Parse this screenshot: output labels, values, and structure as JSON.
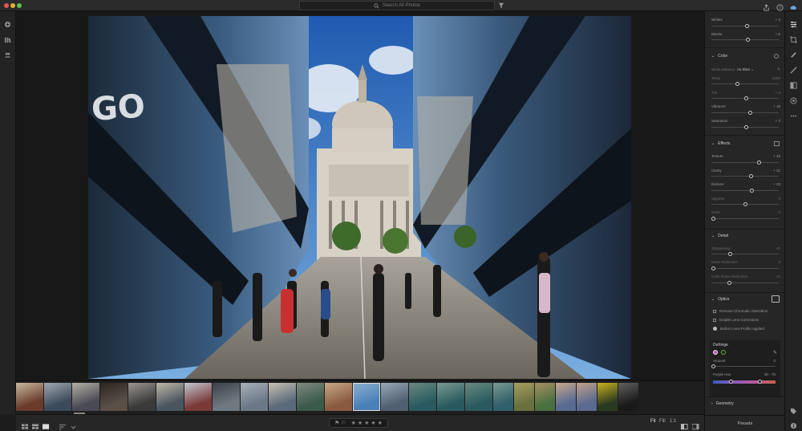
{
  "topbar": {
    "search_placeholder": "Search All Photos"
  },
  "panel": {
    "light_rows": [
      {
        "label": "Whites",
        "value": "+ 4",
        "pos": 0.53
      },
      {
        "label": "Blacks",
        "value": "+ 6",
        "pos": 0.54
      }
    ],
    "color": {
      "title": "Color",
      "white_balance_label": "White Balance",
      "white_balance_value": "As Shot",
      "rows": [
        {
          "label": "Temp",
          "value": "5450",
          "pos": 0.38
        },
        {
          "label": "Tint",
          "value": "+ 3",
          "pos": 0.52
        },
        {
          "label": "Vibrance",
          "value": "+ 16",
          "pos": 0.58
        },
        {
          "label": "Saturation",
          "value": "+ 3",
          "pos": 0.52
        }
      ]
    },
    "effects": {
      "title": "Effects",
      "rows": [
        {
          "label": "Texture",
          "value": "+ 46",
          "pos": 0.72
        },
        {
          "label": "Clarity",
          "value": "+ 21",
          "pos": 0.6
        },
        {
          "label": "Dehaze",
          "value": "+ 23",
          "pos": 0.61
        },
        {
          "label": "Vignette",
          "value": "0",
          "pos": 0.5
        },
        {
          "label": "Grain",
          "value": "0",
          "pos": 0.0
        }
      ]
    },
    "detail": {
      "title": "Detail",
      "rows": [
        {
          "label": "Sharpening",
          "value": "40",
          "pos": 0.27
        },
        {
          "label": "Noise Reduction",
          "value": "0",
          "pos": 0.0
        },
        {
          "label": "Color Noise Reduction",
          "value": "25",
          "pos": 0.25
        }
      ]
    },
    "optics": {
      "title": "Optics",
      "checks": [
        "Remove Chromatic Aberration",
        "Enable Lens Corrections",
        "Built-in Lens Profile Applied"
      ]
    },
    "defringe": {
      "title": "Defringe",
      "amount_label": "Amount",
      "amount_value": "0",
      "purple_hue_label": "Purple Hue",
      "purple_hue_value": "30 - 70"
    },
    "geometry_title": "Geometry",
    "presets_label": "Presets"
  },
  "bottombar": {
    "zoom_fit": "Fit",
    "zoom_fill": "Fill",
    "zoom_1to1": "1:1"
  },
  "filmstrip": {
    "thumbs": [
      [
        "#6a3a2a",
        "#c9b9a0"
      ],
      [
        "#3a4a5a",
        "#a0a8b0"
      ],
      [
        "#4a4a55",
        "#b5b0a5"
      ],
      [
        "#5a5048",
        "#2a2520"
      ],
      [
        "#3a3a3a",
        "#9a9590"
      ],
      [
        "#4a5560",
        "#c0b8a8"
      ],
      [
        "#7a3a3a",
        "#c0c8d0"
      ],
      [
        "#707880",
        "#3a4048"
      ],
      [
        "#6a7888",
        "#a8b0b8"
      ],
      [
        "#5a6a7a",
        "#c8c0b0"
      ],
      [
        "#3a5a4a",
        "#808a80"
      ],
      [
        "#8a5a40",
        "#c8a888"
      ],
      [
        "#4a80b8",
        "#8ab0d0"
      ],
      [
        "#506070",
        "#9aa8b8"
      ],
      [
        "#2a5a60",
        "#6a8a80"
      ],
      [
        "#2a5a60",
        "#7a9a90"
      ],
      [
        "#2a5a60",
        "#6a8a80"
      ],
      [
        "#30606a",
        "#7a9a90"
      ],
      [
        "#6a7040",
        "#a8a060"
      ],
      [
        "#4a7040",
        "#a89060"
      ],
      [
        "#5a6a90",
        "#c8a890"
      ],
      [
        "#5a6a90",
        "#c0a088"
      ],
      [
        "#2a3a20",
        "#c8b020"
      ],
      [
        "#1a1a1a",
        "#606060"
      ]
    ]
  },
  "colors": {
    "accent": "#d9d9d9",
    "panel": "#262626",
    "canvas": "#181818"
  }
}
